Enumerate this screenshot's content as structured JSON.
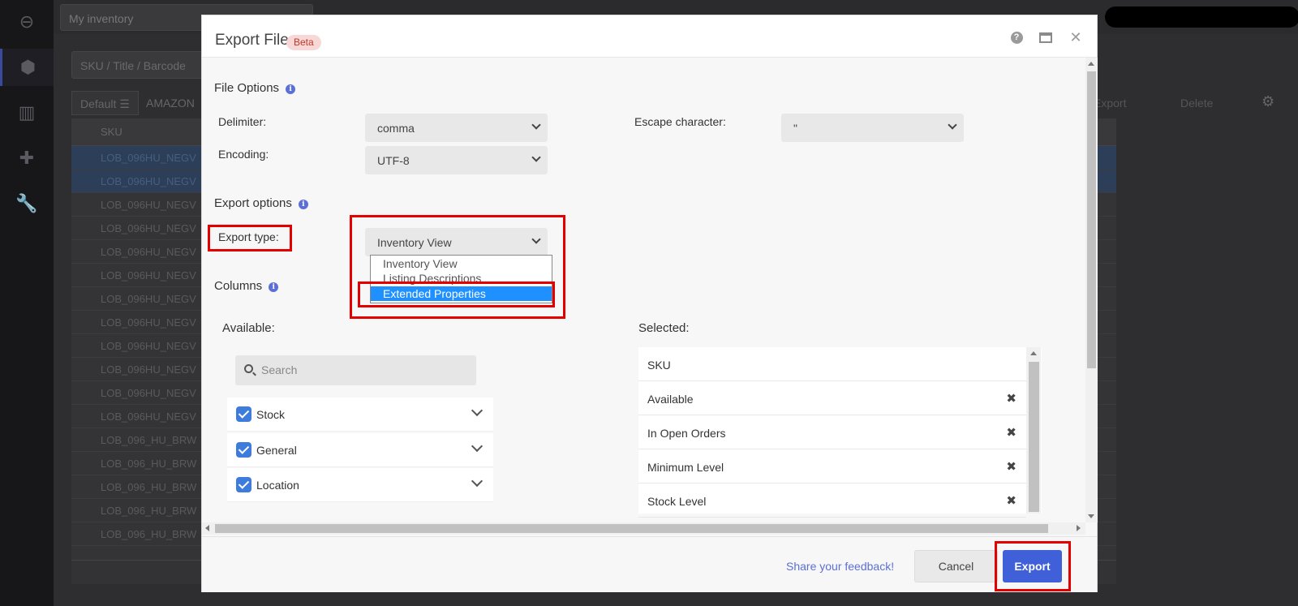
{
  "background": {
    "tab_title": "My inventory",
    "search_placeholder": "SKU / Title / Barcode",
    "view_tabs": [
      "Default",
      "AMAZON"
    ],
    "grid_header": "SKU",
    "toolbar": {
      "export_label": "Export",
      "delete_label": "Delete"
    },
    "rows": [
      "LOB_096HU_NEGV",
      "LOB_096HU_NEGV",
      "LOB_096HU_NEGV",
      "LOB_096HU_NEGV",
      "LOB_096HU_NEGV",
      "LOB_096HU_NEGV",
      "LOB_096HU_NEGV",
      "LOB_096HU_NEGV",
      "LOB_096HU_NEGV",
      "LOB_096HU_NEGV",
      "LOB_096HU_NEGV",
      "LOB_096HU_NEGV",
      "LOB_096_HU_BRW",
      "LOB_096_HU_BRW",
      "LOB_096_HU_BRW",
      "LOB_096_HU_BRW",
      "LOB_096_HU_BRW"
    ]
  },
  "modal": {
    "title": "Export File",
    "badge": "Beta",
    "file_options": {
      "title": "File Options",
      "delimiter_label": "Delimiter:",
      "delimiter_value": "comma",
      "encoding_label": "Encoding:",
      "encoding_value": "UTF-8",
      "escape_label": "Escape character:",
      "escape_value": "\""
    },
    "export_options": {
      "title": "Export options",
      "type_label": "Export type:",
      "type_value": "Inventory View",
      "type_options": [
        "Inventory View",
        "Listing Descriptions",
        "Extended Properties"
      ],
      "highlighted_option": "Extended Properties"
    },
    "columns": {
      "title": "Columns",
      "available_label": "Available:",
      "selected_label": "Selected:",
      "search_placeholder": "Search",
      "groups": [
        "Stock",
        "General",
        "Location"
      ],
      "selected_items": [
        "SKU",
        "Available",
        "In Open Orders",
        "Minimum Level",
        "Stock Level"
      ]
    },
    "footer": {
      "feedback_link": "Share your feedback!",
      "cancel_label": "Cancel",
      "export_label": "Export"
    }
  },
  "colors": {
    "accent": "#3f60d8",
    "highlight_box": "#e50000",
    "dropdown_selected": "#1e90ff",
    "beta_bg": "#f8d7d7"
  }
}
